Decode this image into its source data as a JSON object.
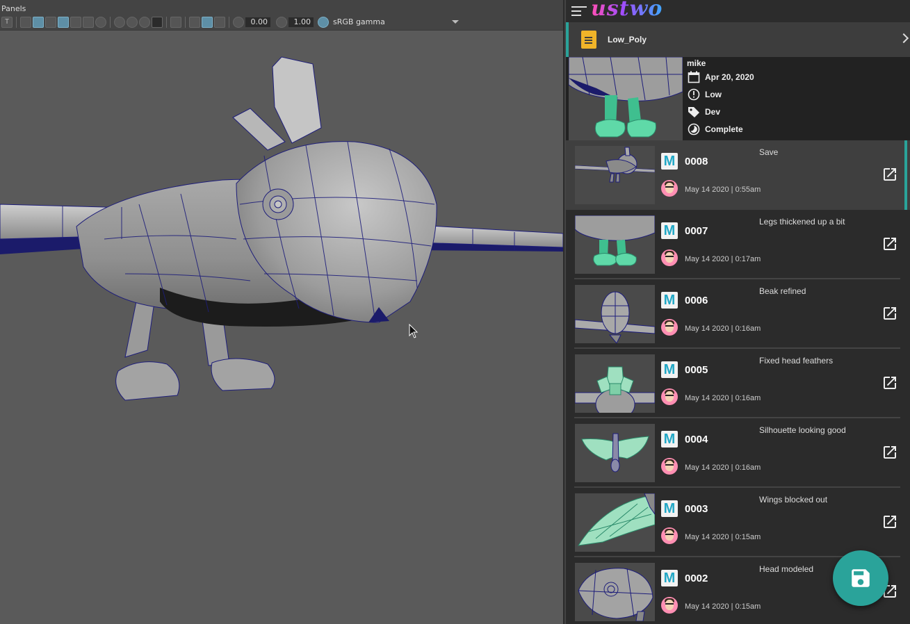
{
  "viewport": {
    "menu_panels": "Panels",
    "exposure_value": "0.00",
    "gamma_value": "1.00",
    "color_space": "sRGB gamma"
  },
  "panel": {
    "brand": "ustwo",
    "file_name": "Low_Poly",
    "info": {
      "user": "mike",
      "date": "Apr 20, 2020",
      "priority": "Low",
      "tag": "Dev",
      "status": "Complete"
    },
    "versions": [
      {
        "number": "0008",
        "message": "Save",
        "date": "May 14 2020 | 0:55am"
      },
      {
        "number": "0007",
        "message": "Legs thickened up a bit",
        "date": "May 14 2020 | 0:17am"
      },
      {
        "number": "0006",
        "message": "Beak refined",
        "date": "May 14 2020 | 0:16am"
      },
      {
        "number": "0005",
        "message": "Fixed head feathers",
        "date": "May 14 2020 | 0:16am"
      },
      {
        "number": "0004",
        "message": "Silhouette looking good",
        "date": "May 14 2020 | 0:16am"
      },
      {
        "number": "0003",
        "message": "Wings blocked out",
        "date": "May 14 2020 | 0:15am"
      },
      {
        "number": "0002",
        "message": "Head modeled",
        "date": "May 14 2020 | 0:15am"
      }
    ],
    "maya_letter": "M"
  },
  "colors": {
    "accent": "#2aa39a",
    "file_icon": "#f0b429",
    "maya_icon": "#23a8c6",
    "panel_bg": "#2c2c2c",
    "viewport_bg": "#5a5a5a"
  },
  "icons": [
    "menu-icon",
    "file-icon",
    "calendar-icon",
    "priority-icon",
    "tag-icon",
    "status-icon",
    "maya-icon",
    "avatar",
    "open-external-icon",
    "save-icon",
    "chevron-right-icon"
  ]
}
